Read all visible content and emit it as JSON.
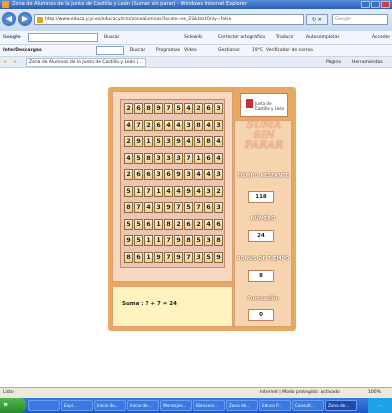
{
  "window": {
    "title": "Zona de Alumnos de la Junta de Castilla y León (Sumar sin parar) - Windows Internet Explorer"
  },
  "address_bar": {
    "url": "http://www.educa.jcyl.es/educacyl/cm/zonaalumnos?locale=es_ES&textOnly=false",
    "search_placeholder": "Google"
  },
  "toolbar_google": {
    "label": "Google",
    "items": [
      "Buscar",
      "Sidewiki",
      "Corrector ortográfico",
      "Traducir",
      "Autocompletar"
    ],
    "right": "Acceder"
  },
  "toolbar_inter": {
    "label": "InterDescargas",
    "items": [
      "Buscar",
      "Programas",
      "Vídeo",
      "Gestionar",
      "19°C",
      "Verificador de correo"
    ]
  },
  "favorites": {
    "tab_label": "Zona de Alumnos de la Junta de Castilla y León (...",
    "commands": [
      "Página",
      "Herramientas"
    ]
  },
  "game": {
    "grid": [
      [
        "2",
        "6",
        "8",
        "9",
        "7",
        "5",
        "4",
        "2",
        "6",
        "3"
      ],
      [
        "4",
        "7",
        "2",
        "6",
        "4",
        "4",
        "3",
        "8",
        "4",
        "3"
      ],
      [
        "2",
        "9",
        "1",
        "5",
        "3",
        "9",
        "4",
        "5",
        "8",
        "4"
      ],
      [
        "4",
        "5",
        "8",
        "3",
        "3",
        "3",
        "7",
        "1",
        "6",
        "4"
      ],
      [
        "2",
        "6",
        "6",
        "3",
        "6",
        "9",
        "3",
        "4",
        "4",
        "3"
      ],
      [
        "5",
        "1",
        "7",
        "1",
        "4",
        "4",
        "9",
        "4",
        "3",
        "2"
      ],
      [
        "8",
        "7",
        "4",
        "3",
        "9",
        "7",
        "5",
        "7",
        "6",
        "3"
      ],
      [
        "5",
        "5",
        "6",
        "1",
        "8",
        "2",
        "6",
        "2",
        "4",
        "6"
      ],
      [
        "9",
        "5",
        "1",
        "1",
        "7",
        "9",
        "8",
        "5",
        "3",
        "8"
      ],
      [
        "8",
        "6",
        "1",
        "9",
        "7",
        "9",
        "7",
        "3",
        "5",
        "9"
      ]
    ],
    "formula": "Suma : ? + 7 = 24",
    "logo_text": "Junta de Castilla y León",
    "title_art": "SUMA SIN PARAR",
    "time_label": "TIEMPO RESTANTE",
    "time_value": "118",
    "number_label": "NÚMERO",
    "number_value": "24",
    "bonus_label": "BONUS DE TIEMPO",
    "bonus_value": "8",
    "score_label": "Puntuación",
    "score_value": "0"
  },
  "status_bar": {
    "left": "Listo",
    "zone": "Internet | Modo protegido: activado",
    "zoom": "100%"
  },
  "taskbar": {
    "tasks": [
      "",
      "Expl...",
      "Inicio de...",
      "Inicio de...",
      "Mensajes...",
      "Bienveni...",
      "Zona de...",
      "Educa P...",
      "Consult...",
      "Zona de..."
    ],
    "clock": "..."
  }
}
